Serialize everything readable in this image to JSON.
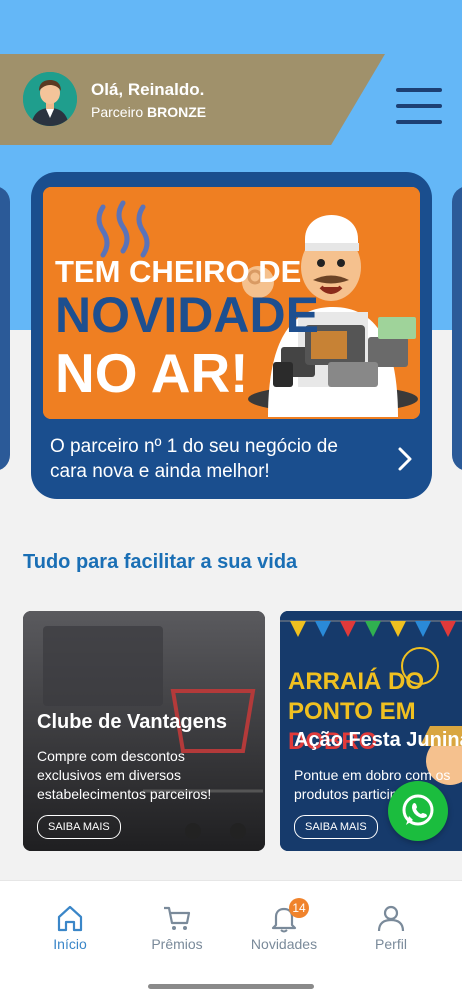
{
  "header": {
    "greeting": "Olá, Reinaldo.",
    "partner_prefix": "Parceiro",
    "partner_level": "BRONZE"
  },
  "banner": {
    "headline_line1": "TEM CHEIRO DE",
    "headline_line2": "NOVIDADE",
    "headline_line3": "NO AR!",
    "caption": "O parceiro nº 1 do seu negócio de cara nova e ainda melhor!"
  },
  "section": {
    "title": "Tudo para facilitar a sua vida"
  },
  "cards": [
    {
      "title": "Clube de Vantagens",
      "description": "Compre com descontos exclusivos em diversos estabelecimentos parceiros!",
      "button": "SAIBA MAIS"
    },
    {
      "title": "Ação Festa Junina",
      "art_text_line1": "ARRAIÁ DO",
      "art_text_line2": "PONTO EM",
      "art_text_line3": "DOBRO",
      "description": "Pontue em dobro com os produtos participantes!",
      "button": "SAIBA MAIS"
    }
  ],
  "bottom_nav": {
    "items": [
      {
        "label": "Início",
        "icon": "home-icon"
      },
      {
        "label": "Prêmios",
        "icon": "cart-icon"
      },
      {
        "label": "Novidades",
        "icon": "bell-icon",
        "badge": "14"
      },
      {
        "label": "Perfil",
        "icon": "user-icon"
      }
    ]
  },
  "colors": {
    "sky": "#64b7f7",
    "band": "#a0916b",
    "banner_bg": "#1a4e8e",
    "banner_art": "#ef7f22",
    "section_title": "#1a6fb5",
    "whatsapp": "#1bbd3e",
    "badge": "#f0832c"
  }
}
